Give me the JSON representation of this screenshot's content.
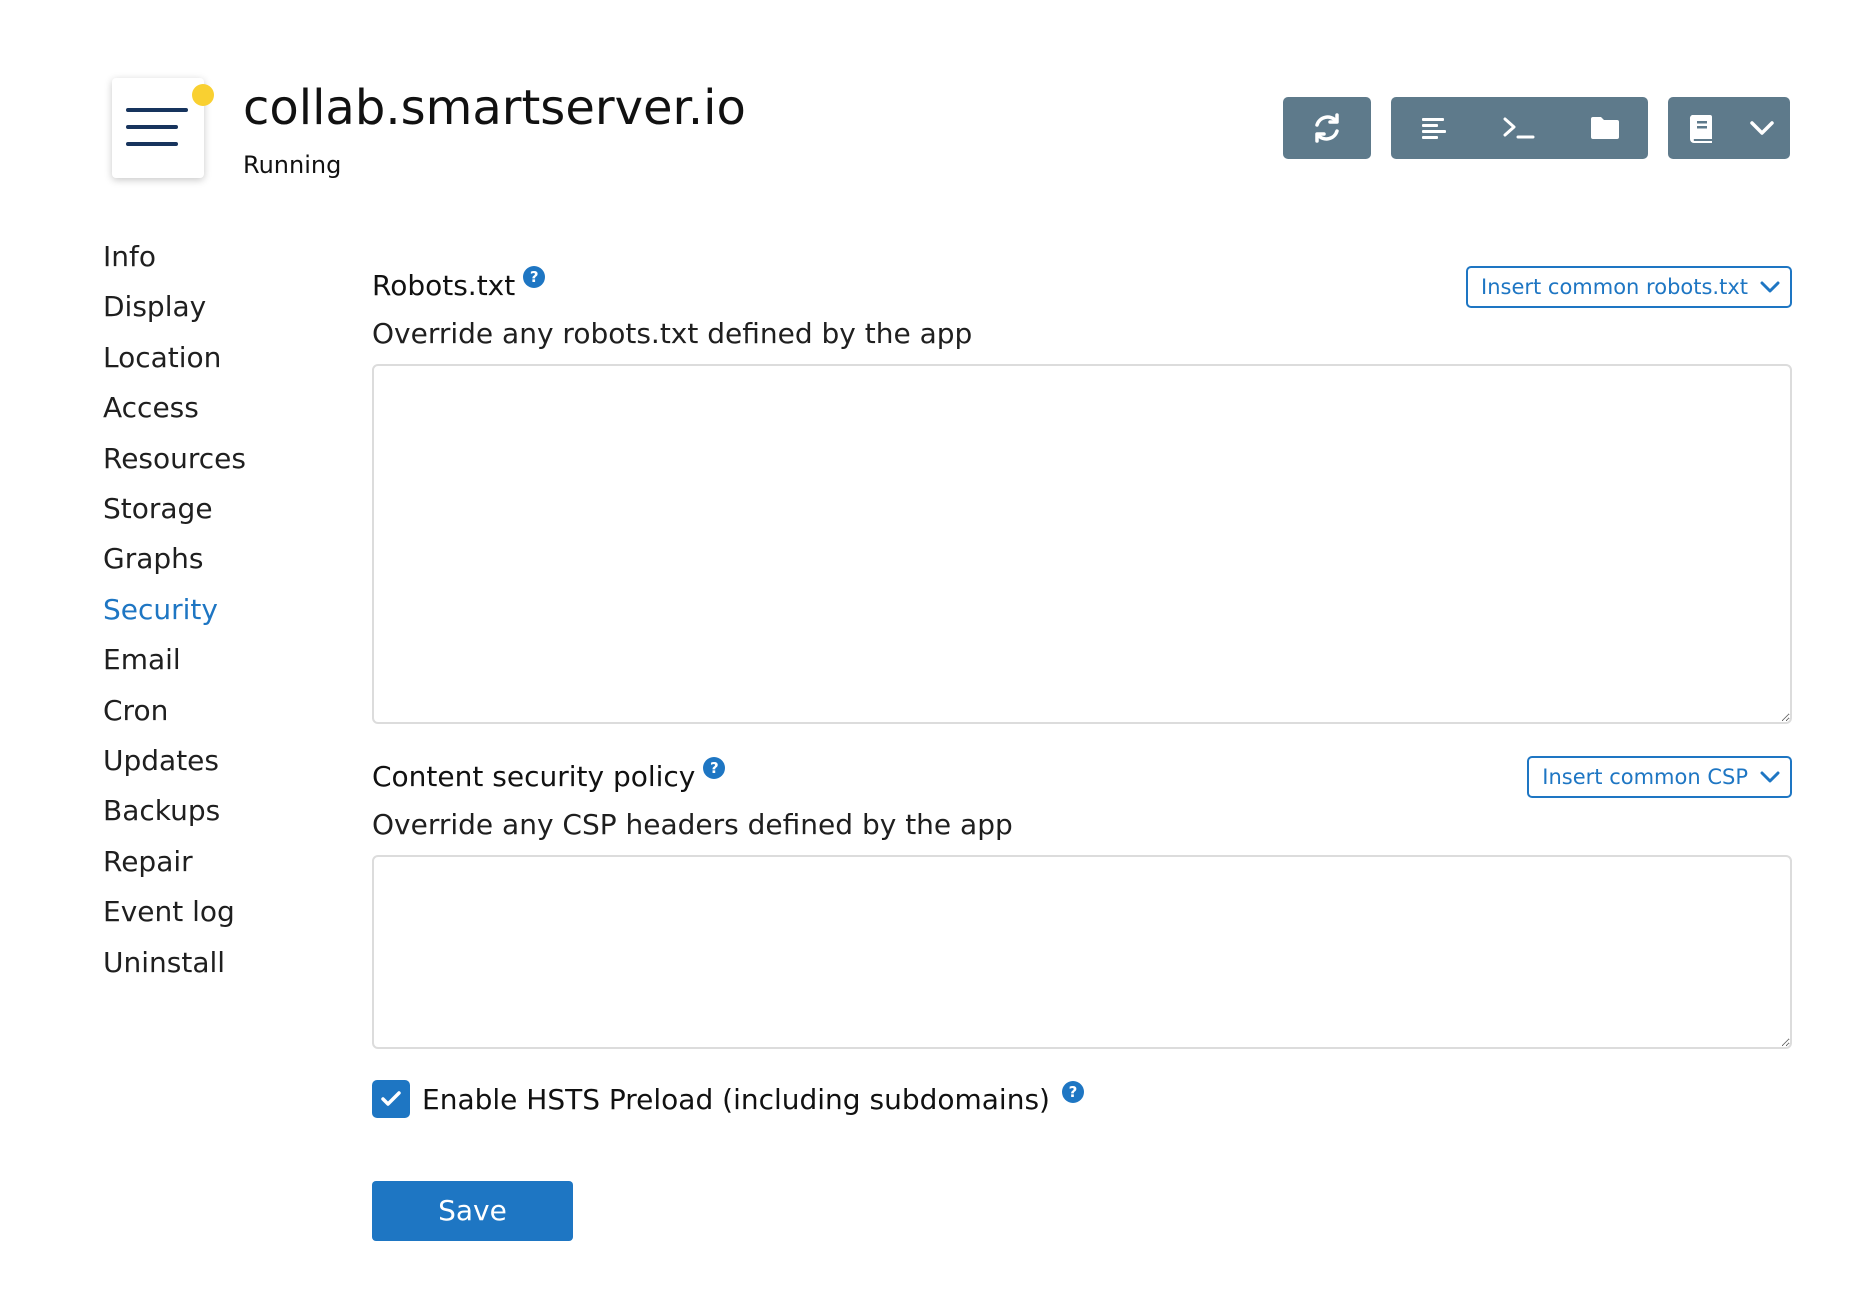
{
  "app": {
    "title": "collab.smartserver.io",
    "status": "Running",
    "status_dot_color": "#f9d031"
  },
  "toolbar": {
    "buttons": [
      {
        "icon": "refresh-icon"
      },
      {
        "icon": "logs-icon"
      },
      {
        "icon": "terminal-icon"
      },
      {
        "icon": "folder-icon"
      },
      {
        "icon": "book-icon"
      },
      {
        "icon": "chevron-down-icon"
      }
    ],
    "color": "#5e7a8b"
  },
  "sidebar": {
    "items": [
      {
        "label": "Info"
      },
      {
        "label": "Display"
      },
      {
        "label": "Location"
      },
      {
        "label": "Access"
      },
      {
        "label": "Resources"
      },
      {
        "label": "Storage"
      },
      {
        "label": "Graphs"
      },
      {
        "label": "Security",
        "active": true
      },
      {
        "label": "Email"
      },
      {
        "label": "Cron"
      },
      {
        "label": "Updates"
      },
      {
        "label": "Backups"
      },
      {
        "label": "Repair"
      },
      {
        "label": "Event log"
      },
      {
        "label": "Uninstall"
      }
    ],
    "active_color": "#1e76c3"
  },
  "robots": {
    "title": "Robots.txt",
    "description": "Override any robots.txt defined by the app",
    "insert_label": "Insert common robots.txt",
    "value": ""
  },
  "csp": {
    "title": "Content security policy",
    "description": "Override any CSP headers defined by the app",
    "insert_label": "Insert common CSP",
    "value": ""
  },
  "hsts": {
    "label": "Enable HSTS Preload (including subdomains)",
    "checked": true
  },
  "help_glyph": "?",
  "save_label": "Save",
  "accent_color": "#1e76c3"
}
